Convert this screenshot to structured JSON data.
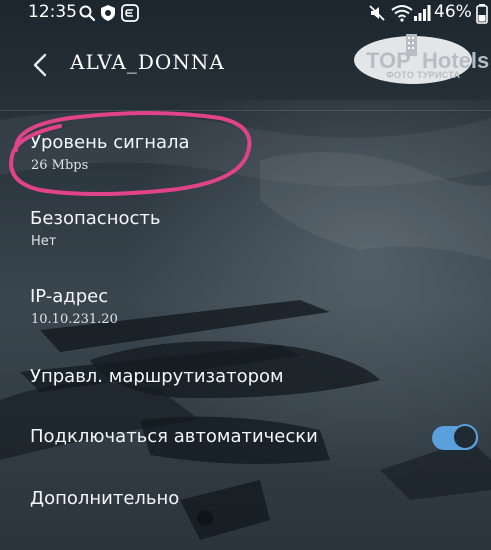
{
  "status_bar": {
    "time": "12:35",
    "battery": "46%",
    "icons": [
      "search-icon",
      "shield-icon",
      "e-app-icon",
      "mute-icon",
      "wifi-icon",
      "signal-icon",
      "battery-icon"
    ]
  },
  "header": {
    "title": "ALVA_DONNA",
    "back_icon": "chevron-left-icon"
  },
  "watermark": {
    "brand_top": "TOP",
    "brand_hotels": "Hotels",
    "subtitle": "ФОТО ТУРИСТА"
  },
  "items": [
    {
      "title": "Уровень сигнала",
      "subtitle": "26 Mbps"
    },
    {
      "title": "Безопасность",
      "subtitle": "Нет"
    },
    {
      "title": "IP-адрес",
      "subtitle": "10.10.231.20"
    },
    {
      "title": "Управл. маршрутизатором"
    },
    {
      "title": "Подключаться автоматически",
      "toggle": "on"
    },
    {
      "title": "Дополнительно"
    }
  ],
  "colors": {
    "accent": "#5b9fdc",
    "highlight_marker": "#e0438a",
    "background": "#1b242c"
  }
}
